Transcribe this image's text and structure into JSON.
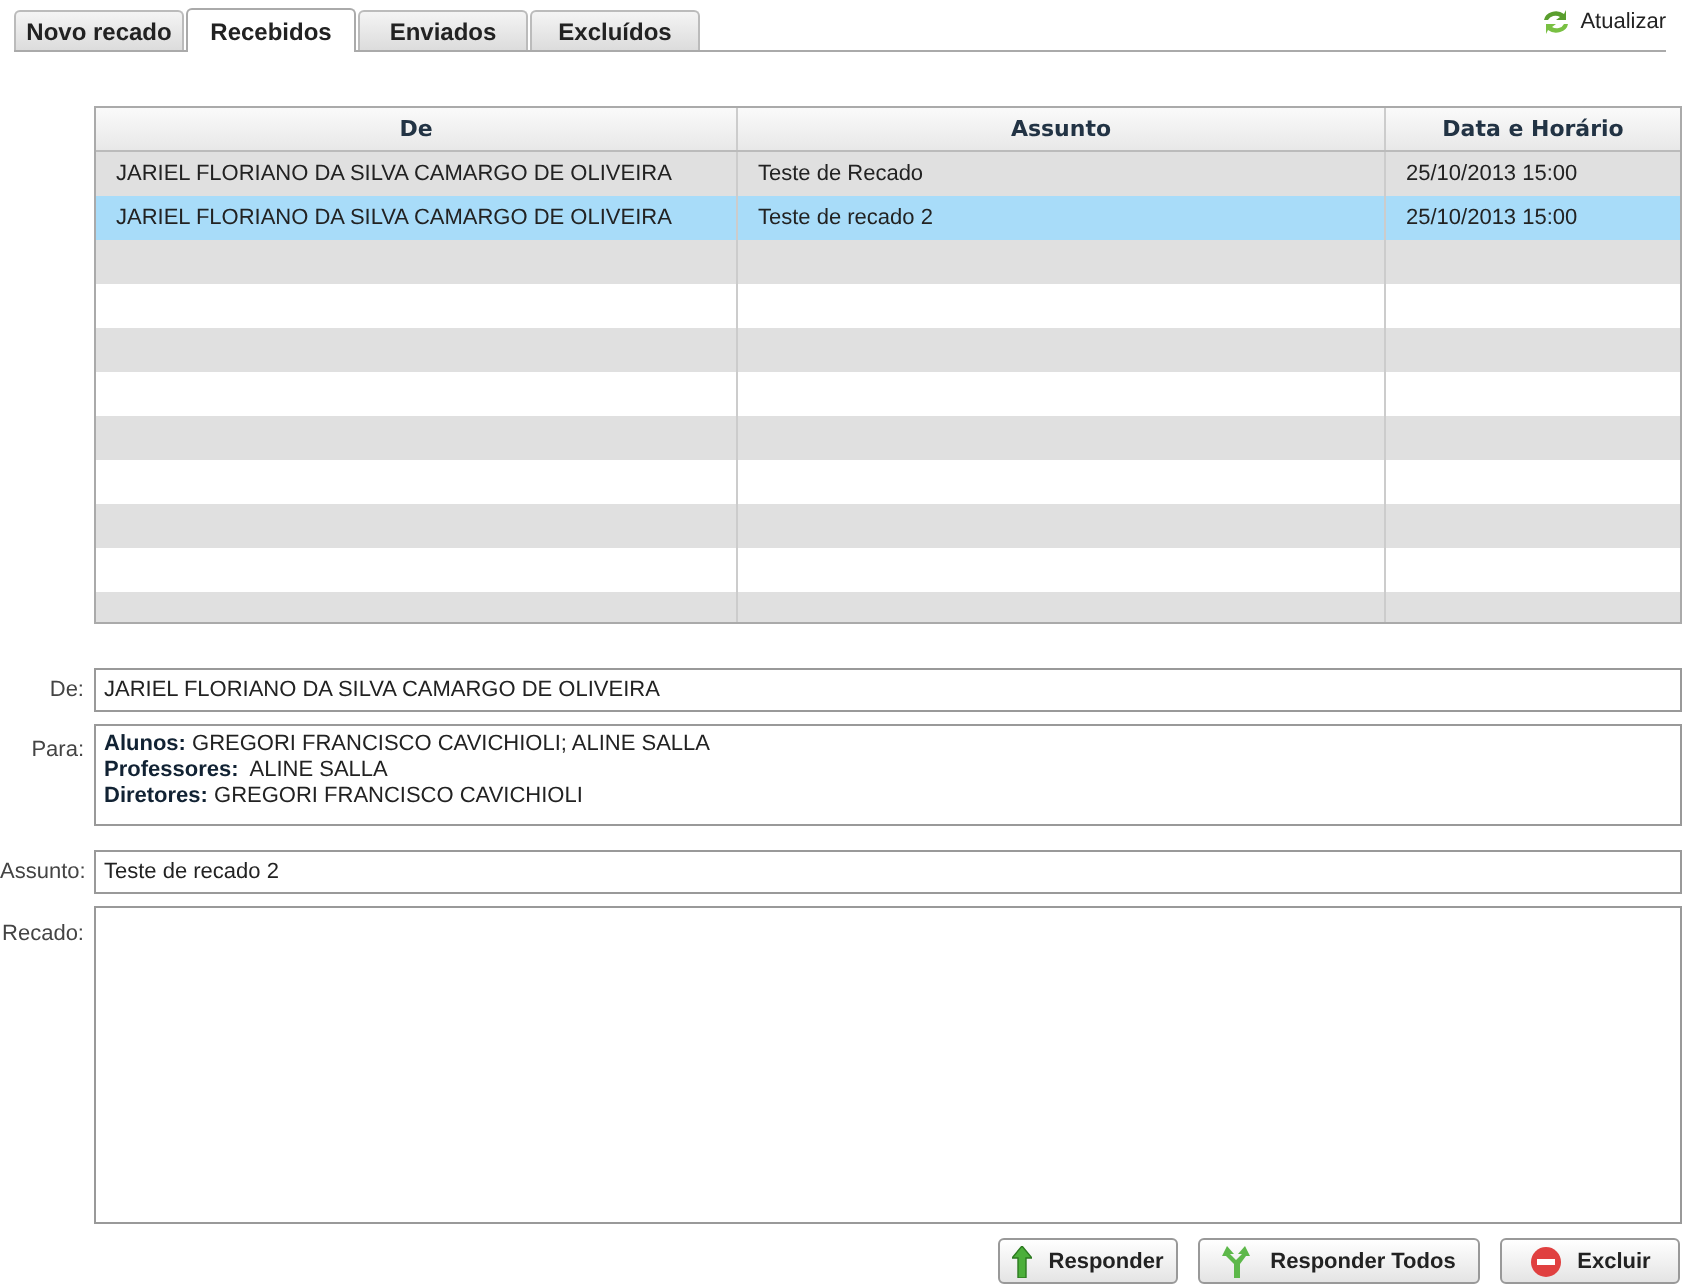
{
  "tabs": [
    {
      "label": "Novo recado",
      "selected": false
    },
    {
      "label": "Recebidos",
      "selected": true
    },
    {
      "label": "Enviados",
      "selected": false
    },
    {
      "label": "Excluídos",
      "selected": false
    }
  ],
  "refresh": {
    "label": "Atualizar"
  },
  "table": {
    "columns": [
      "De",
      "Assunto",
      "Data e Horário"
    ],
    "rows": [
      {
        "cells": [
          "JARIEL FLORIANO DA SILVA CAMARGO DE OLIVEIRA",
          "Teste de Recado",
          "25/10/2013 15:00"
        ],
        "selected": false
      },
      {
        "cells": [
          "JARIEL FLORIANO DA SILVA CAMARGO DE OLIVEIRA",
          "Teste de recado 2",
          "25/10/2013 15:00"
        ],
        "selected": true
      }
    ]
  },
  "detail": {
    "from": {
      "label": "De:",
      "value": "JARIEL FLORIANO DA SILVA CAMARGO DE OLIVEIRA"
    },
    "to": {
      "label": "Para:",
      "lines": [
        "**Alunos:** GREGORI FRANCISCO CAVICHIOLI; ALINE SALLA",
        "**Professores:**  ALINE SALLA",
        "**Diretores:** GREGORI FRANCISCO CAVICHIOLI"
      ]
    },
    "subject": {
      "label": "Assunto:",
      "value": "Teste de recado 2"
    },
    "message": {
      "label": "Recado:"
    }
  },
  "buttons": [
    {
      "kind": "reply",
      "label": "Responder"
    },
    {
      "kind": "reply-all",
      "label": "Responder Todos"
    },
    {
      "kind": "delete",
      "label": "Excluir"
    }
  ]
}
